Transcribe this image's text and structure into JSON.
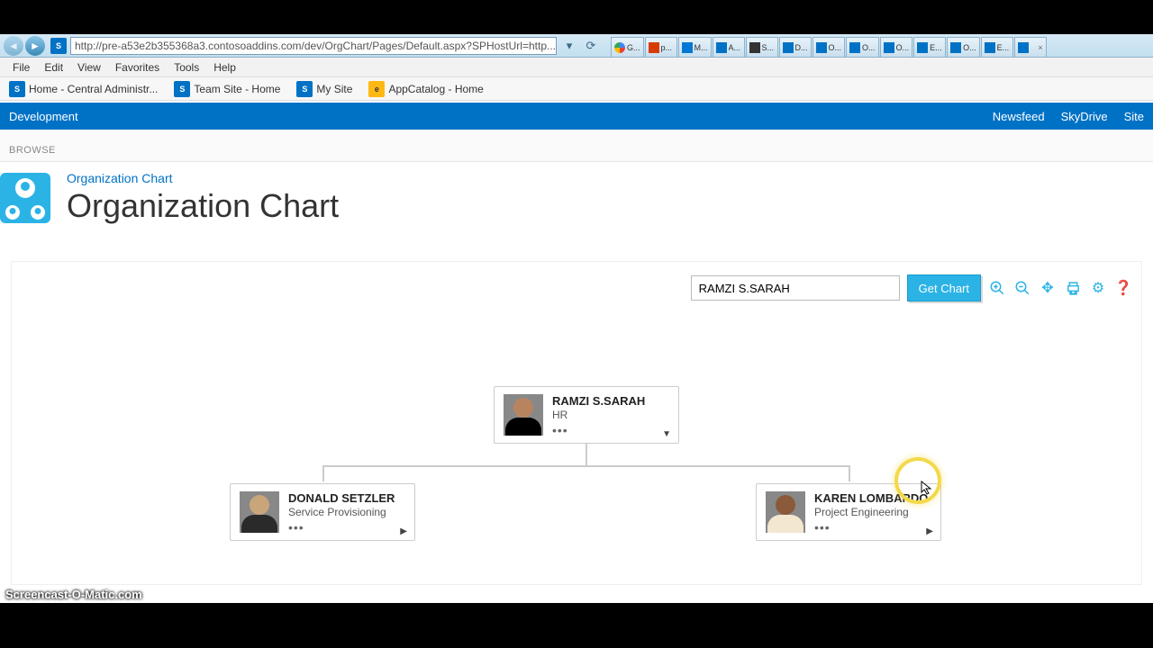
{
  "browser": {
    "url": "http://pre-a53e2b355368a3.contosoaddins.com/dev/OrgChart/Pages/Default.aspx?SPHostUrl=http...",
    "menus": [
      "File",
      "Edit",
      "View",
      "Favorites",
      "Tools",
      "Help"
    ],
    "favorites": [
      {
        "label": "Home - Central Administr..."
      },
      {
        "label": "Team Site - Home"
      },
      {
        "label": "My Site"
      },
      {
        "label": "AppCatalog - Home"
      }
    ],
    "tabs": [
      {
        "label": "G..."
      },
      {
        "label": "p..."
      },
      {
        "label": "M..."
      },
      {
        "label": "A..."
      },
      {
        "label": "S..."
      },
      {
        "label": "D..."
      },
      {
        "label": "O..."
      },
      {
        "label": "O..."
      },
      {
        "label": "O..."
      },
      {
        "label": "E..."
      },
      {
        "label": "O..."
      },
      {
        "label": "E..."
      },
      {
        "label": ""
      }
    ]
  },
  "suite": {
    "site_title": "Development",
    "links": [
      "Newsfeed",
      "SkyDrive",
      "Site"
    ]
  },
  "ribbon": {
    "tab": "BROWSE"
  },
  "page": {
    "crumb": "Organization Chart",
    "title": "Organization Chart"
  },
  "toolbar": {
    "search_value": "RAMZI S.SARAH",
    "get_chart": "Get Chart"
  },
  "chart_data": {
    "type": "tree",
    "root": {
      "name": "RAMZI S.SARAH",
      "dept": "HR"
    },
    "children": [
      {
        "name": "DONALD SETZLER",
        "dept": "Service Provisioning"
      },
      {
        "name": "KAREN LOMBARDO",
        "dept": "Project Engineering"
      }
    ]
  },
  "watermark": "Screencast-O-Matic.com"
}
